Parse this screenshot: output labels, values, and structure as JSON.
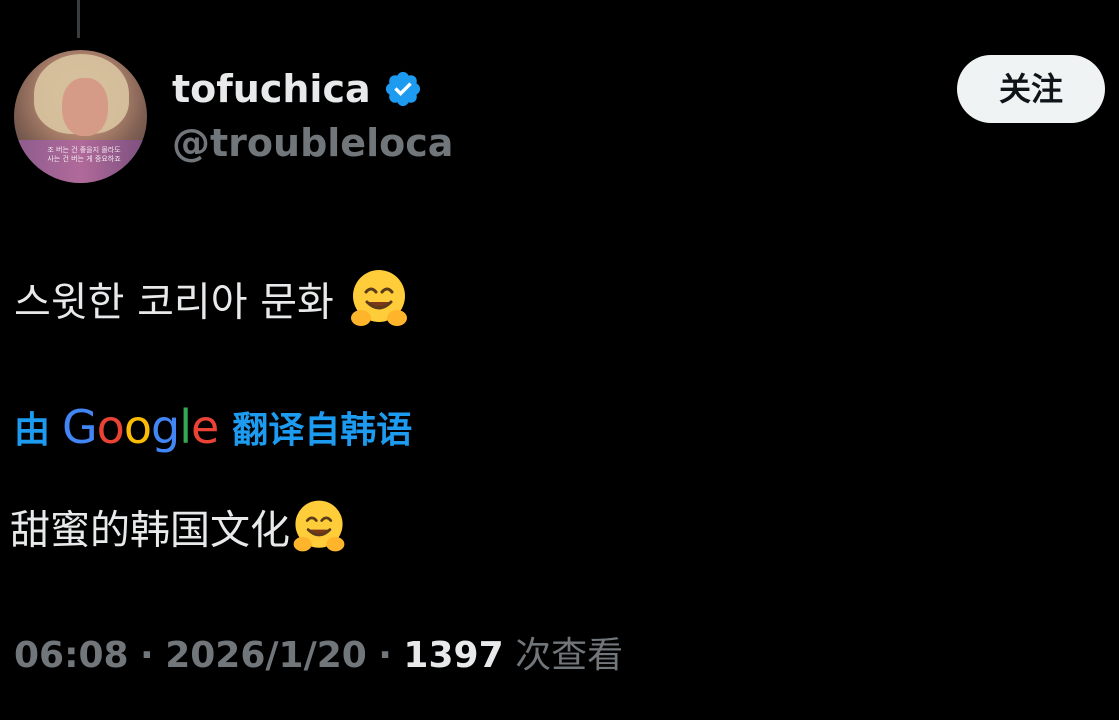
{
  "author": {
    "display_name": "tofuchica",
    "handle": "@troubleloca",
    "verified": true,
    "verified_icon": "verified-badge-icon",
    "avatar_caption": "조 버는 건 좋을지 몰라도\n사는 건 버는 게 중요하죠"
  },
  "follow_button": {
    "label": "关注"
  },
  "tweet": {
    "text": "스윗한 코리아 문화",
    "emoji_icon": "hugging-face-icon"
  },
  "translation": {
    "prefix": "由",
    "provider_letters": [
      "G",
      "o",
      "o",
      "g",
      "l",
      "e"
    ],
    "suffix": "翻译自韩语",
    "translated_text": "甜蜜的韩国文化"
  },
  "meta": {
    "time": "06:08",
    "separator": "·",
    "date": "2026/1/20",
    "views_count": "1397",
    "views_label": "次查看"
  },
  "colors": {
    "background": "#000000",
    "text_primary": "#e7e9ea",
    "text_secondary": "#71767b",
    "accent_blue": "#1d9bf0",
    "follow_button_bg": "#eff3f4"
  }
}
